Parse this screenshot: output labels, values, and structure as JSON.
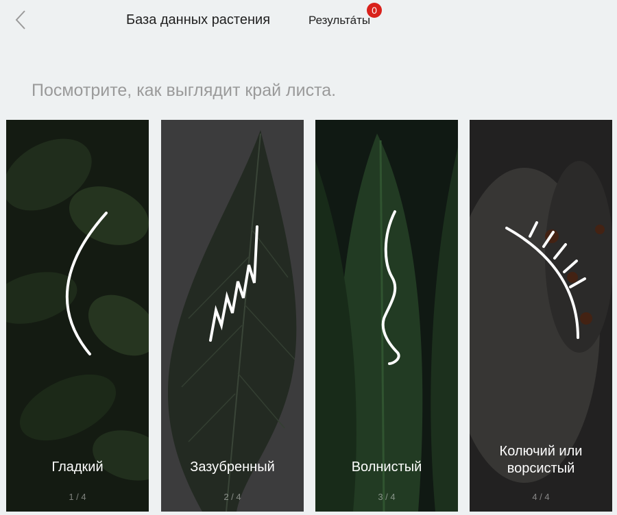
{
  "header": {
    "title": "База данных растения",
    "results_label": "Результáты",
    "results_count": "0"
  },
  "prompt": "Посмотрите, как выглядит край листа.",
  "cards": [
    {
      "label": "Гладкий",
      "pager": "1 / 4",
      "icon": "smooth-edge-icon"
    },
    {
      "label": "Зазубренный",
      "pager": "2 / 4",
      "icon": "serrated-edge-icon"
    },
    {
      "label": "Волнистый",
      "pager": "3 / 4",
      "icon": "wavy-edge-icon"
    },
    {
      "label": "Колючий или ворсистый",
      "pager": "4 / 4",
      "icon": "spiny-edge-icon"
    }
  ]
}
